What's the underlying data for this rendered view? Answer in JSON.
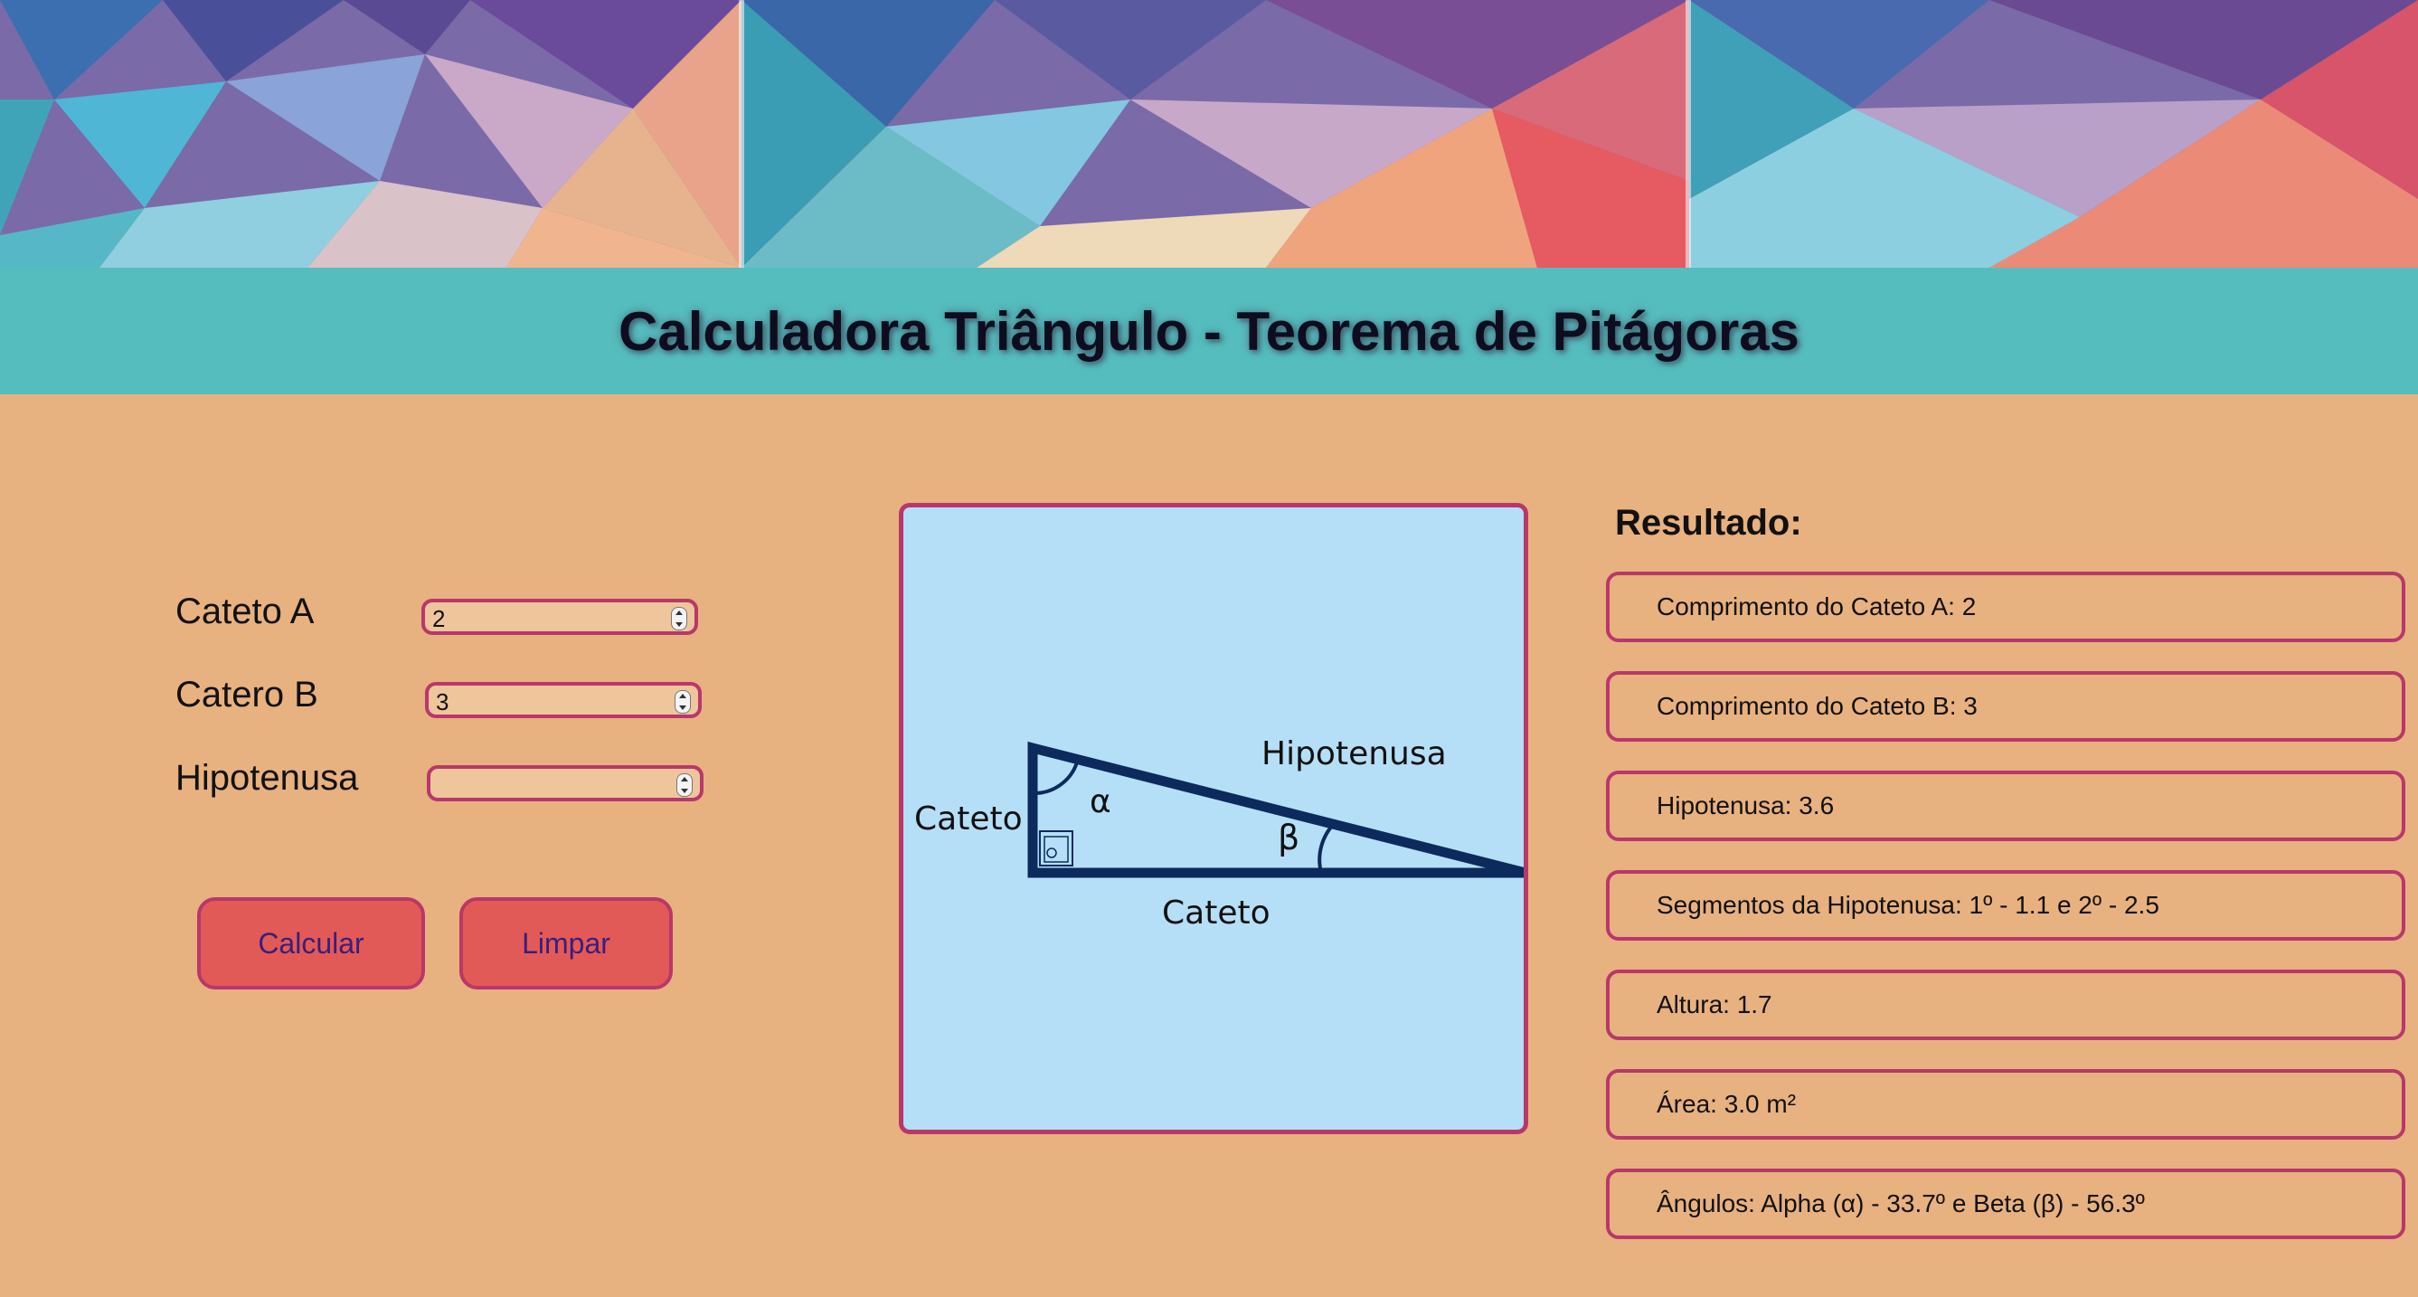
{
  "page": {
    "title": "Calculadora Triângulo - Teorema de Pitágoras"
  },
  "form": {
    "cateto_a": {
      "label": "Cateto A",
      "value": "2"
    },
    "cateto_b": {
      "label": "Catero B",
      "value": "3"
    },
    "hipotenusa": {
      "label": "Hipotenusa",
      "value": ""
    },
    "calcular_label": "Calcular",
    "limpar_label": "Limpar"
  },
  "diagram": {
    "cateto_vertical": "Cateto",
    "cateto_horizontal": "Cateto",
    "hipotenusa": "Hipotenusa",
    "alpha": "α",
    "beta": "β"
  },
  "results": {
    "title": "Resultado:",
    "items": [
      "Comprimento do Cateto A: 2",
      "Comprimento do Cateto B: 3",
      "Hipotenusa: 3.6",
      "Segmentos da Hipotenusa: 1º - 1.1 e 2º - 2.5",
      "Altura: 1.7",
      "Área: 3.0 m²",
      "Ângulos: Alpha (α) - 33.7º e Beta (β) - 56.3º"
    ]
  },
  "colors": {
    "page_bg": "#e8b180",
    "title_bar": "#56bdbf",
    "border_accent": "#b8386a",
    "button_bg": "#e25a57",
    "button_text": "#3a1e7a",
    "diagram_bg": "#b5dff7",
    "triangle": "#0d2a5c"
  }
}
